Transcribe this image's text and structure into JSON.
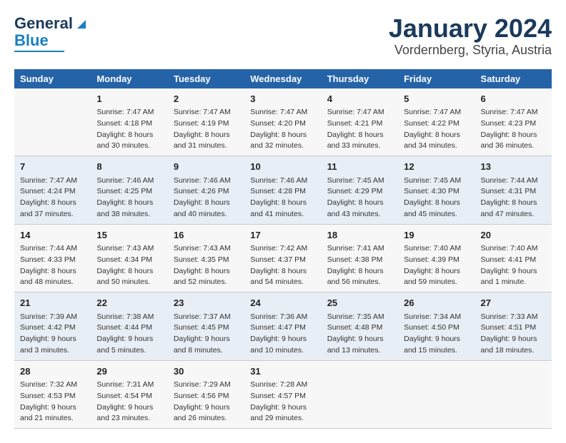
{
  "header": {
    "logo_general": "General",
    "logo_blue": "Blue",
    "title": "January 2024",
    "subtitle": "Vordernberg, Styria, Austria"
  },
  "days_of_week": [
    "Sunday",
    "Monday",
    "Tuesday",
    "Wednesday",
    "Thursday",
    "Friday",
    "Saturday"
  ],
  "weeks": [
    [
      {
        "day": "",
        "sunrise": "",
        "sunset": "",
        "daylight": ""
      },
      {
        "day": "1",
        "sunrise": "Sunrise: 7:47 AM",
        "sunset": "Sunset: 4:18 PM",
        "daylight": "Daylight: 8 hours and 30 minutes."
      },
      {
        "day": "2",
        "sunrise": "Sunrise: 7:47 AM",
        "sunset": "Sunset: 4:19 PM",
        "daylight": "Daylight: 8 hours and 31 minutes."
      },
      {
        "day": "3",
        "sunrise": "Sunrise: 7:47 AM",
        "sunset": "Sunset: 4:20 PM",
        "daylight": "Daylight: 8 hours and 32 minutes."
      },
      {
        "day": "4",
        "sunrise": "Sunrise: 7:47 AM",
        "sunset": "Sunset: 4:21 PM",
        "daylight": "Daylight: 8 hours and 33 minutes."
      },
      {
        "day": "5",
        "sunrise": "Sunrise: 7:47 AM",
        "sunset": "Sunset: 4:22 PM",
        "daylight": "Daylight: 8 hours and 34 minutes."
      },
      {
        "day": "6",
        "sunrise": "Sunrise: 7:47 AM",
        "sunset": "Sunset: 4:23 PM",
        "daylight": "Daylight: 8 hours and 36 minutes."
      }
    ],
    [
      {
        "day": "7",
        "sunrise": "Sunrise: 7:47 AM",
        "sunset": "Sunset: 4:24 PM",
        "daylight": "Daylight: 8 hours and 37 minutes."
      },
      {
        "day": "8",
        "sunrise": "Sunrise: 7:46 AM",
        "sunset": "Sunset: 4:25 PM",
        "daylight": "Daylight: 8 hours and 38 minutes."
      },
      {
        "day": "9",
        "sunrise": "Sunrise: 7:46 AM",
        "sunset": "Sunset: 4:26 PM",
        "daylight": "Daylight: 8 hours and 40 minutes."
      },
      {
        "day": "10",
        "sunrise": "Sunrise: 7:46 AM",
        "sunset": "Sunset: 4:28 PM",
        "daylight": "Daylight: 8 hours and 41 minutes."
      },
      {
        "day": "11",
        "sunrise": "Sunrise: 7:45 AM",
        "sunset": "Sunset: 4:29 PM",
        "daylight": "Daylight: 8 hours and 43 minutes."
      },
      {
        "day": "12",
        "sunrise": "Sunrise: 7:45 AM",
        "sunset": "Sunset: 4:30 PM",
        "daylight": "Daylight: 8 hours and 45 minutes."
      },
      {
        "day": "13",
        "sunrise": "Sunrise: 7:44 AM",
        "sunset": "Sunset: 4:31 PM",
        "daylight": "Daylight: 8 hours and 47 minutes."
      }
    ],
    [
      {
        "day": "14",
        "sunrise": "Sunrise: 7:44 AM",
        "sunset": "Sunset: 4:33 PM",
        "daylight": "Daylight: 8 hours and 48 minutes."
      },
      {
        "day": "15",
        "sunrise": "Sunrise: 7:43 AM",
        "sunset": "Sunset: 4:34 PM",
        "daylight": "Daylight: 8 hours and 50 minutes."
      },
      {
        "day": "16",
        "sunrise": "Sunrise: 7:43 AM",
        "sunset": "Sunset: 4:35 PM",
        "daylight": "Daylight: 8 hours and 52 minutes."
      },
      {
        "day": "17",
        "sunrise": "Sunrise: 7:42 AM",
        "sunset": "Sunset: 4:37 PM",
        "daylight": "Daylight: 8 hours and 54 minutes."
      },
      {
        "day": "18",
        "sunrise": "Sunrise: 7:41 AM",
        "sunset": "Sunset: 4:38 PM",
        "daylight": "Daylight: 8 hours and 56 minutes."
      },
      {
        "day": "19",
        "sunrise": "Sunrise: 7:40 AM",
        "sunset": "Sunset: 4:39 PM",
        "daylight": "Daylight: 8 hours and 59 minutes."
      },
      {
        "day": "20",
        "sunrise": "Sunrise: 7:40 AM",
        "sunset": "Sunset: 4:41 PM",
        "daylight": "Daylight: 9 hours and 1 minute."
      }
    ],
    [
      {
        "day": "21",
        "sunrise": "Sunrise: 7:39 AM",
        "sunset": "Sunset: 4:42 PM",
        "daylight": "Daylight: 9 hours and 3 minutes."
      },
      {
        "day": "22",
        "sunrise": "Sunrise: 7:38 AM",
        "sunset": "Sunset: 4:44 PM",
        "daylight": "Daylight: 9 hours and 5 minutes."
      },
      {
        "day": "23",
        "sunrise": "Sunrise: 7:37 AM",
        "sunset": "Sunset: 4:45 PM",
        "daylight": "Daylight: 9 hours and 8 minutes."
      },
      {
        "day": "24",
        "sunrise": "Sunrise: 7:36 AM",
        "sunset": "Sunset: 4:47 PM",
        "daylight": "Daylight: 9 hours and 10 minutes."
      },
      {
        "day": "25",
        "sunrise": "Sunrise: 7:35 AM",
        "sunset": "Sunset: 4:48 PM",
        "daylight": "Daylight: 9 hours and 13 minutes."
      },
      {
        "day": "26",
        "sunrise": "Sunrise: 7:34 AM",
        "sunset": "Sunset: 4:50 PM",
        "daylight": "Daylight: 9 hours and 15 minutes."
      },
      {
        "day": "27",
        "sunrise": "Sunrise: 7:33 AM",
        "sunset": "Sunset: 4:51 PM",
        "daylight": "Daylight: 9 hours and 18 minutes."
      }
    ],
    [
      {
        "day": "28",
        "sunrise": "Sunrise: 7:32 AM",
        "sunset": "Sunset: 4:53 PM",
        "daylight": "Daylight: 9 hours and 21 minutes."
      },
      {
        "day": "29",
        "sunrise": "Sunrise: 7:31 AM",
        "sunset": "Sunset: 4:54 PM",
        "daylight": "Daylight: 9 hours and 23 minutes."
      },
      {
        "day": "30",
        "sunrise": "Sunrise: 7:29 AM",
        "sunset": "Sunset: 4:56 PM",
        "daylight": "Daylight: 9 hours and 26 minutes."
      },
      {
        "day": "31",
        "sunrise": "Sunrise: 7:28 AM",
        "sunset": "Sunset: 4:57 PM",
        "daylight": "Daylight: 9 hours and 29 minutes."
      },
      {
        "day": "",
        "sunrise": "",
        "sunset": "",
        "daylight": ""
      },
      {
        "day": "",
        "sunrise": "",
        "sunset": "",
        "daylight": ""
      },
      {
        "day": "",
        "sunrise": "",
        "sunset": "",
        "daylight": ""
      }
    ]
  ]
}
